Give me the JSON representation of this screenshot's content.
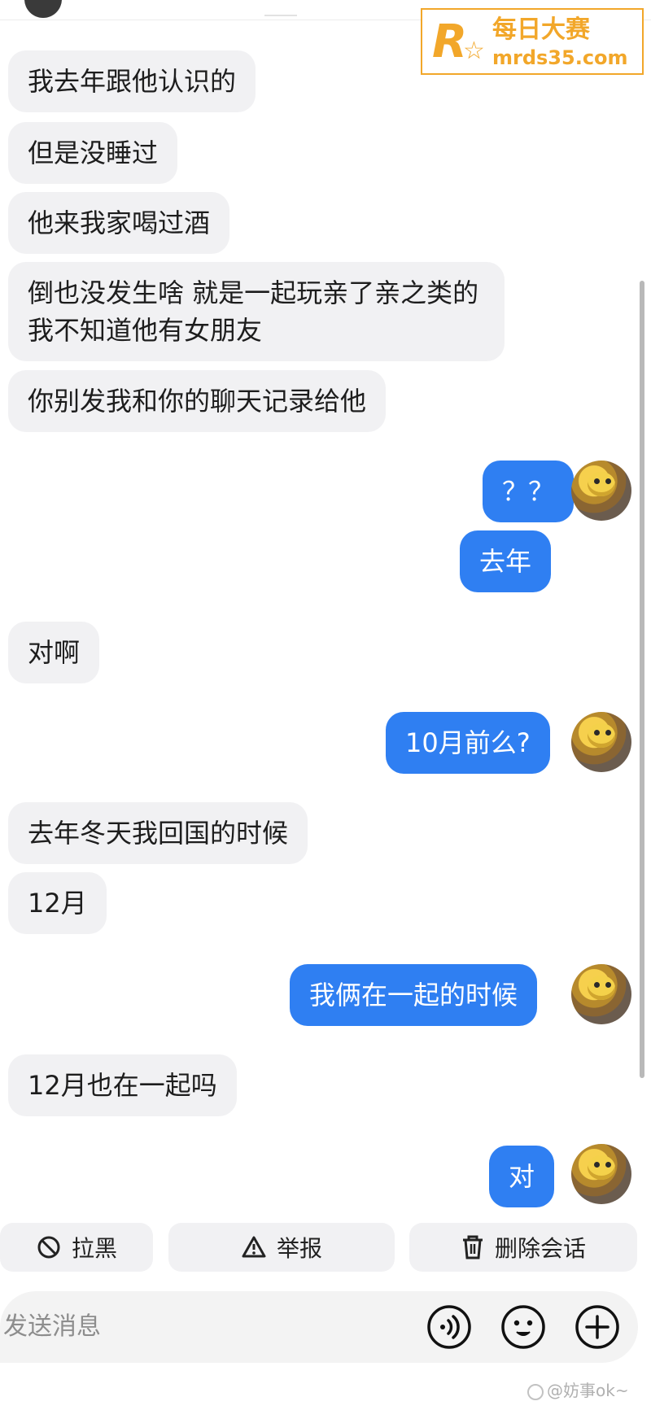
{
  "watermark": {
    "logo_letter": "R",
    "name": "每日大赛",
    "url": "mrds35.com"
  },
  "messages": [
    {
      "side": "in",
      "text": "我去年跟他认识的"
    },
    {
      "side": "in",
      "text": "但是没睡过"
    },
    {
      "side": "in",
      "text": "他来我家喝过酒"
    },
    {
      "side": "in",
      "text": "倒也没发生啥 就是一起玩亲了亲之类的 我不知道他有女朋友"
    },
    {
      "side": "in",
      "text": "你别发我和你的聊天记录给他"
    },
    {
      "side": "out",
      "text": "？？"
    },
    {
      "side": "out",
      "text": "去年"
    },
    {
      "side": "in",
      "text": "对啊"
    },
    {
      "side": "out",
      "text": "10月前么?"
    },
    {
      "side": "in",
      "text": "去年冬天我回国的时候"
    },
    {
      "side": "in",
      "text": "12月"
    },
    {
      "side": "out",
      "text": "我俩在一起的时候"
    },
    {
      "side": "in",
      "text": "12月也在一起吗"
    },
    {
      "side": "out",
      "text": "对"
    }
  ],
  "actions": {
    "block_label": "拉黑",
    "report_label": "举报",
    "delete_label": "删除会话"
  },
  "input": {
    "placeholder": "发送消息"
  },
  "icons": {
    "block": "block-icon",
    "report": "warning-icon",
    "delete": "trash-icon",
    "voice": "voice-icon",
    "emoji": "emoji-icon",
    "plus": "plus-icon"
  },
  "colors": {
    "outgoing_bubble": "#2f7ff2",
    "incoming_bubble": "#f1f1f3",
    "watermark": "#f2a72a"
  },
  "footer_watermark": "@妨事ok~"
}
